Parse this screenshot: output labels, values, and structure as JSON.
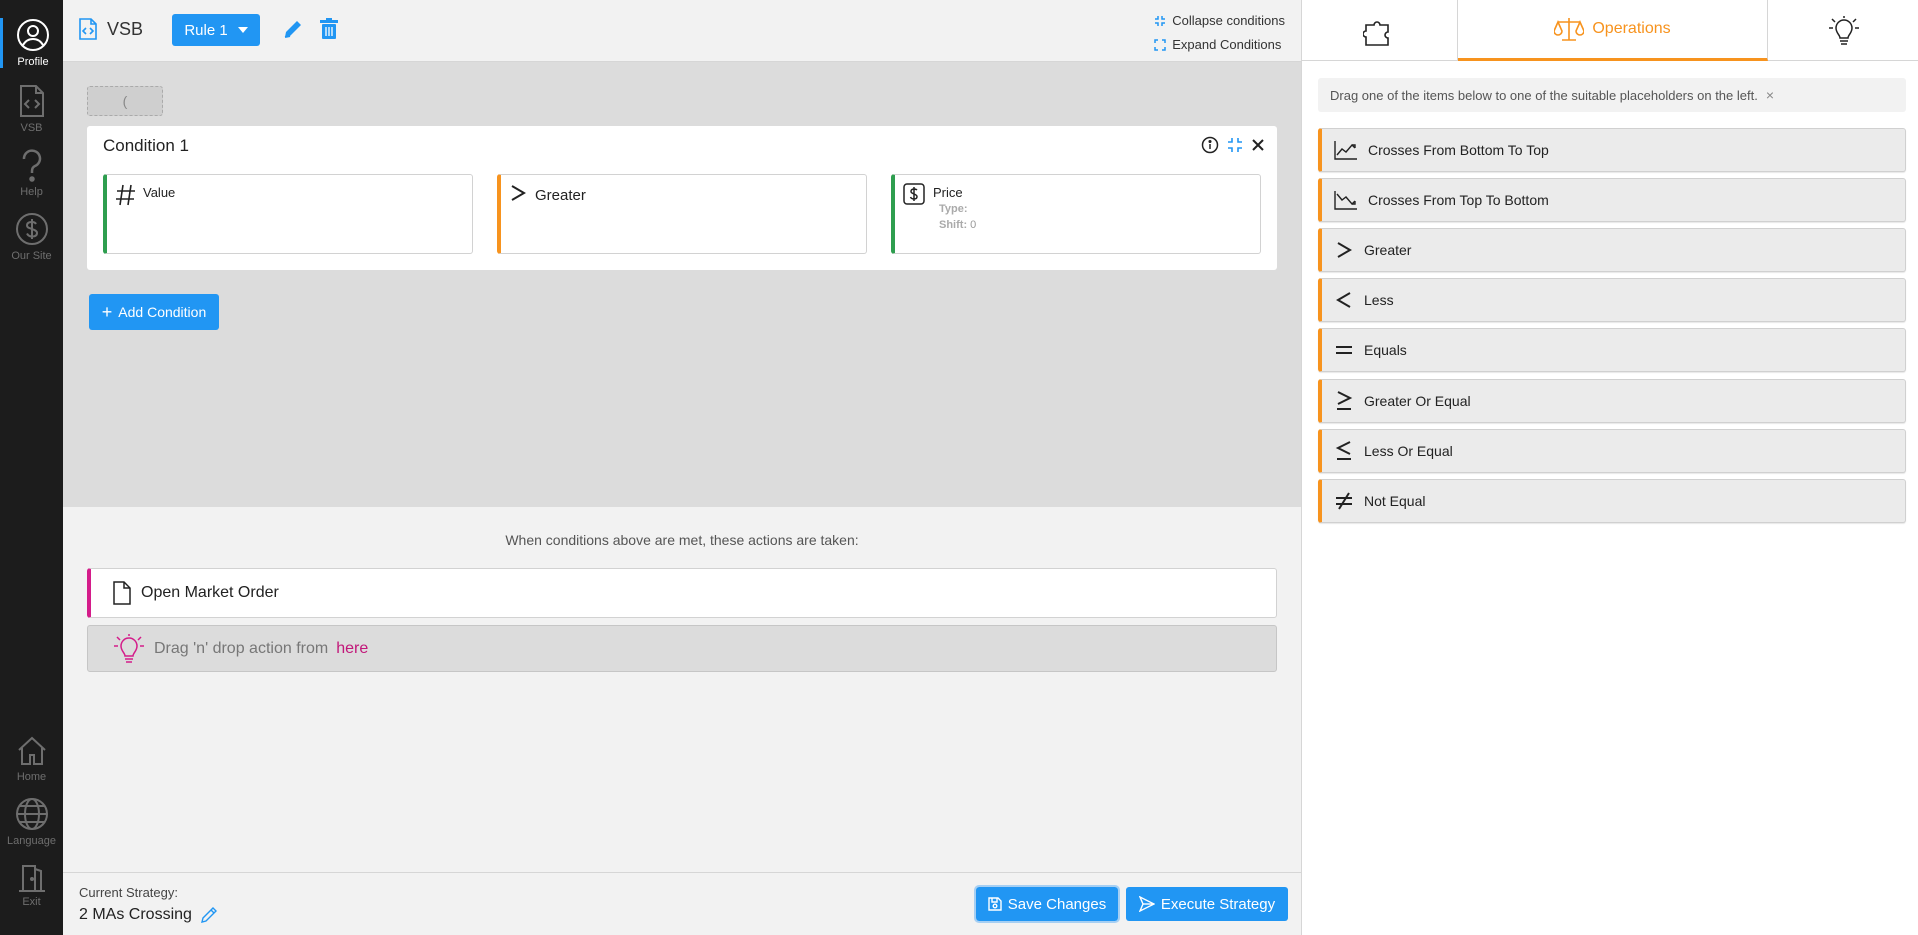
{
  "leftnav": {
    "items": [
      {
        "label": "Profile",
        "icon": "user-circle-icon"
      },
      {
        "label": "VSB",
        "icon": "code-file-icon"
      },
      {
        "label": "Help",
        "icon": "question-icon"
      },
      {
        "label": "Our Site",
        "icon": "dollar-icon"
      },
      {
        "label": "Home",
        "icon": "home-icon"
      },
      {
        "label": "Language",
        "icon": "globe-icon"
      },
      {
        "label": "Exit",
        "icon": "door-icon"
      }
    ]
  },
  "topbar": {
    "app_title": "VSB",
    "rule_label": "Rule 1",
    "collapse_label": "Collapse conditions",
    "expand_label": "Expand Conditions"
  },
  "conditions": {
    "paren": "(",
    "condition": {
      "title": "Condition 1",
      "left": {
        "label": "Value"
      },
      "op": {
        "label": "Greater"
      },
      "right": {
        "label": "Price",
        "type_label": "Type:",
        "type_value": "",
        "shift_label": "Shift:",
        "shift_value": "0"
      }
    },
    "add_label": "Add Condition"
  },
  "actions": {
    "note": "When conditions above are met, these actions are taken:",
    "items": [
      {
        "label": "Open Market Order"
      }
    ],
    "drop_text": "Drag 'n' drop action from",
    "drop_link": "here"
  },
  "bottombar": {
    "current_label": "Current Strategy:",
    "current_name": "2 MAs Crossing",
    "save_label": "Save Changes",
    "execute_label": "Execute Strategy"
  },
  "rightpanel": {
    "tabs": [
      {
        "label": "",
        "icon": "puzzle-icon"
      },
      {
        "label": "Operations",
        "icon": "scales-icon"
      },
      {
        "label": "",
        "icon": "lightbulb-icon"
      }
    ],
    "hint": "Drag one of the items below to one of the suitable placeholders on the left.",
    "hint_close": "×",
    "operations": [
      {
        "label": "Crosses From Bottom To Top",
        "icon": "chart-up-icon"
      },
      {
        "label": "Crosses From Top To Bottom",
        "icon": "chart-down-icon"
      },
      {
        "label": "Greater",
        "icon": "greater-icon"
      },
      {
        "label": "Less",
        "icon": "less-icon"
      },
      {
        "label": "Equals",
        "icon": "equals-icon"
      },
      {
        "label": "Greater Or Equal",
        "icon": "greater-equal-icon"
      },
      {
        "label": "Less Or Equal",
        "icon": "less-equal-icon"
      },
      {
        "label": "Not Equal",
        "icon": "not-equal-icon"
      }
    ]
  },
  "colors": {
    "accent_blue": "#2196f3",
    "accent_orange": "#f7931e",
    "accent_green": "#2e9e4f",
    "accent_magenta": "#d41c8a"
  }
}
